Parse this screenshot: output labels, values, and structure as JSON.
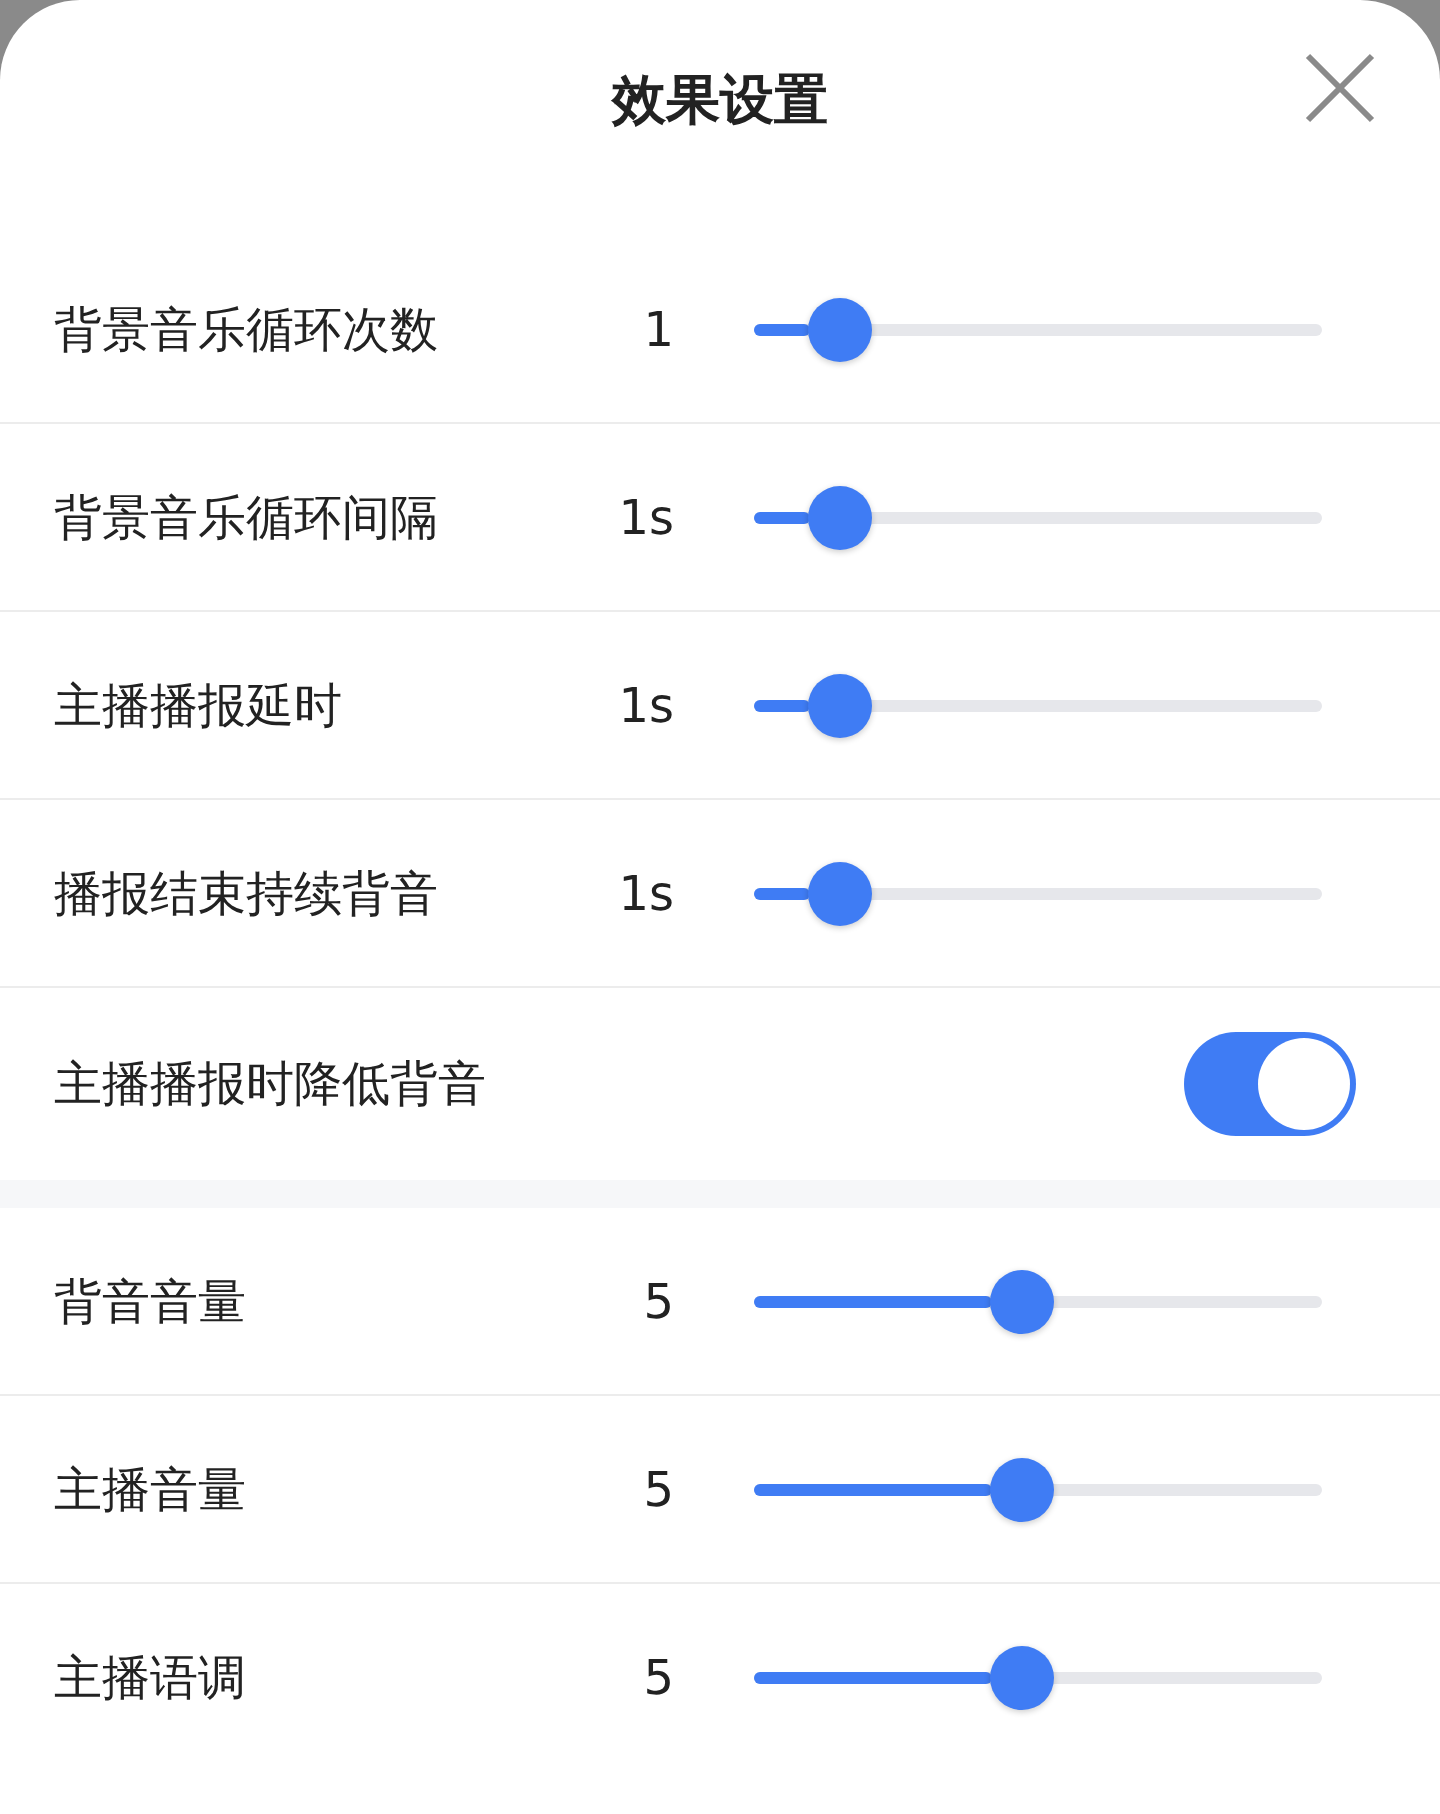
{
  "title": "效果设置",
  "groups": [
    {
      "items": [
        {
          "kind": "slider",
          "label": "背景音乐循环次数",
          "reading": "1",
          "level": 0.1
        },
        {
          "kind": "slider",
          "label": "背景音乐循环间隔",
          "reading": "1s",
          "level": 0.1
        },
        {
          "kind": "slider",
          "label": "主播播报延时",
          "reading": "1s",
          "level": 0.1
        },
        {
          "kind": "slider",
          "label": "播报结束持续背音",
          "reading": "1s",
          "level": 0.1
        },
        {
          "kind": "toggle",
          "label": "主播播报时降低背音",
          "on": true
        }
      ]
    },
    {
      "items": [
        {
          "kind": "slider",
          "label": "背音音量",
          "reading": "5",
          "level": 0.44
        },
        {
          "kind": "slider",
          "label": "主播音量",
          "reading": "5",
          "level": 0.44
        },
        {
          "kind": "slider",
          "label": "主播语调",
          "reading": "5",
          "level": 0.44
        }
      ]
    }
  ]
}
